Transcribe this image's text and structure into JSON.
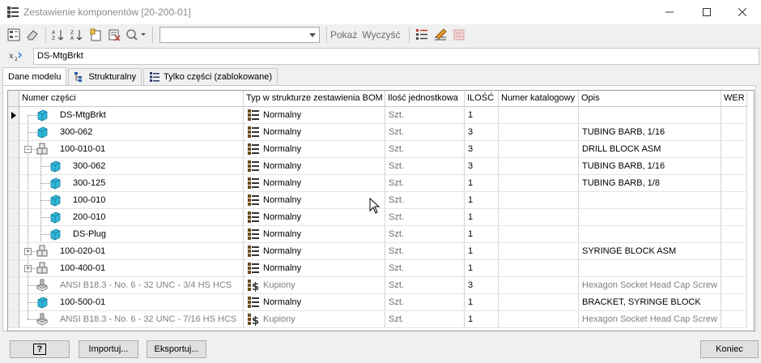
{
  "window": {
    "title": "Zestawienie komponentów [20-200-01]"
  },
  "toolbar": {
    "combo_value": "",
    "show_label": "Pokaż",
    "clear_label": "Wyczyść"
  },
  "part_field": {
    "value": "DS-MtgBrkt"
  },
  "tabs": [
    {
      "label": "Dane modelu"
    },
    {
      "label": "Strukturalny"
    },
    {
      "label": "Tylko części (zablokowane)"
    }
  ],
  "columns": {
    "name": "Numer części",
    "type": "Typ w strukturze zestawienia BOM",
    "unit": "Ilość jednostkowa",
    "qty": "ILOŚĆ",
    "catalog": "Numer katalogowy",
    "desc": "Opis",
    "rev": "WER"
  },
  "rows": [
    {
      "name": "DS-MtgBrkt",
      "type": "Normalny",
      "unit": "Szt.",
      "qty": "1",
      "catalog": "",
      "desc": "",
      "rev": "",
      "icon": "part-icon",
      "selected": true
    },
    {
      "name": "300-062",
      "type": "Normalny",
      "unit": "Szt.",
      "qty": "3",
      "catalog": "",
      "desc": "TUBING BARB, 1/16",
      "rev": "",
      "icon": "part-icon"
    },
    {
      "name": "100-010-01",
      "type": "Normalny",
      "unit": "Szt.",
      "qty": "3",
      "catalog": "",
      "desc": "DRILL BLOCK ASM",
      "rev": "",
      "icon": "assembly-icon",
      "expanded": true
    },
    {
      "name": "300-062",
      "type": "Normalny",
      "unit": "Szt.",
      "qty": "3",
      "catalog": "",
      "desc": "TUBING BARB, 1/16",
      "rev": "",
      "icon": "part-icon",
      "child": true
    },
    {
      "name": "300-125",
      "type": "Normalny",
      "unit": "Szt.",
      "qty": "1",
      "catalog": "",
      "desc": "TUBING BARB, 1/8",
      "rev": "",
      "icon": "part-icon",
      "child": true
    },
    {
      "name": "100-010",
      "type": "Normalny",
      "unit": "Szt.",
      "qty": "1",
      "catalog": "",
      "desc": "",
      "rev": "",
      "icon": "part-icon",
      "child": true
    },
    {
      "name": "200-010",
      "type": "Normalny",
      "unit": "Szt.",
      "qty": "1",
      "catalog": "",
      "desc": "",
      "rev": "",
      "icon": "part-icon",
      "child": true
    },
    {
      "name": "DS-Plug",
      "type": "Normalny",
      "unit": "Szt.",
      "qty": "1",
      "catalog": "",
      "desc": "",
      "rev": "",
      "icon": "part-icon",
      "child": true
    },
    {
      "name": "100-020-01",
      "type": "Normalny",
      "unit": "Szt.",
      "qty": "1",
      "catalog": "",
      "desc": "SYRINGE BLOCK ASM",
      "rev": "",
      "icon": "assembly-icon",
      "collapsed": true
    },
    {
      "name": "100-400-01",
      "type": "Normalny",
      "unit": "Szt.",
      "qty": "1",
      "catalog": "",
      "desc": "",
      "rev": "",
      "icon": "assembly-icon",
      "collapsed": true
    },
    {
      "name": "ANSI B18.3 - No. 6 - 32 UNC - 3/4 HS HCS",
      "type": "Kupiony",
      "unit": "Szt.",
      "qty": "3",
      "catalog": "",
      "desc": "Hexagon Socket Head Cap Screw",
      "rev": "",
      "icon": "content-center-icon",
      "grey": true
    },
    {
      "name": "100-500-01",
      "type": "Normalny",
      "unit": "Szt.",
      "qty": "1",
      "catalog": "",
      "desc": "BRACKET, SYRINGE BLOCK",
      "rev": "",
      "icon": "part-icon"
    },
    {
      "name": "ANSI B18.3 - No. 6 - 32 UNC - 7/16 HS HCS",
      "type": "Kupiony",
      "unit": "Szt.",
      "qty": "1",
      "catalog": "",
      "desc": "Hexagon Socket Head Cap Screw",
      "rev": "",
      "icon": "content-center-icon",
      "grey": true
    }
  ],
  "buttons": {
    "help": "?",
    "import": "Importuj...",
    "export": "Eksportuj...",
    "close": "Koniec"
  },
  "colors": {
    "part_icon": "#2fb6d8",
    "bom_icon": "#5a4a2a",
    "toolbar_red": "#c0392b"
  }
}
